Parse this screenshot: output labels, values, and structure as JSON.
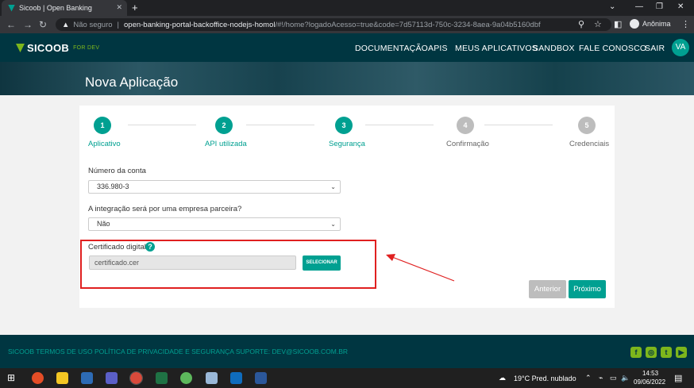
{
  "browser": {
    "tab_title": "Sicoob | Open Banking",
    "tab_close": "✕",
    "new_tab": "+",
    "url_security": "Não seguro",
    "url_domain": "open-banking-portal-backoffice-nodejs-homol",
    "url_path": "/#!/home?logadoAcesso=true&code=7d57113d-750c-3234-8aea-9a04b5160dbf",
    "profile_label": "Anônima"
  },
  "header": {
    "logo": "SICOOB",
    "logo_sub": "FOR DEV",
    "menu": [
      "DOCUMENTAÇÃO",
      "APIS",
      "MEUS APLICATIVOS",
      "SANDBOX",
      "FALE CONOSCO",
      "SAIR"
    ],
    "avatar": "VA"
  },
  "page_title": "Nova Aplicação",
  "steps": [
    {
      "num": "1",
      "label": "Aplicativo",
      "active": true
    },
    {
      "num": "2",
      "label": "API utilizada",
      "active": true
    },
    {
      "num": "3",
      "label": "Segurança",
      "active": true
    },
    {
      "num": "4",
      "label": "Confirmação",
      "active": false
    },
    {
      "num": "5",
      "label": "Credenciais",
      "active": false
    }
  ],
  "form": {
    "account_label": "Número da conta",
    "account_value": "336.980-3",
    "partner_label": "A integração será por uma empresa parceira?",
    "partner_value": "Não",
    "cert_label": "Certificado digital",
    "cert_help": "?",
    "cert_value": "certificado.cer",
    "select_button": "SELECIONAR"
  },
  "buttons": {
    "prev": "Anterior",
    "next": "Próximo"
  },
  "footer": {
    "text": "SICOOB   TERMOS DE USO   POLÍTICA DE PRIVACIDADE E SEGURANÇA   SUPORTE: DEV@SICOOB.COM.BR"
  },
  "taskbar": {
    "weather": "19°C  Pred. nublado",
    "time": "14:53",
    "date": "09/06/2022"
  },
  "colors": {
    "primary": "#00a091",
    "dark": "#003641",
    "accent": "#7db61c",
    "annotation": "#e02020"
  }
}
